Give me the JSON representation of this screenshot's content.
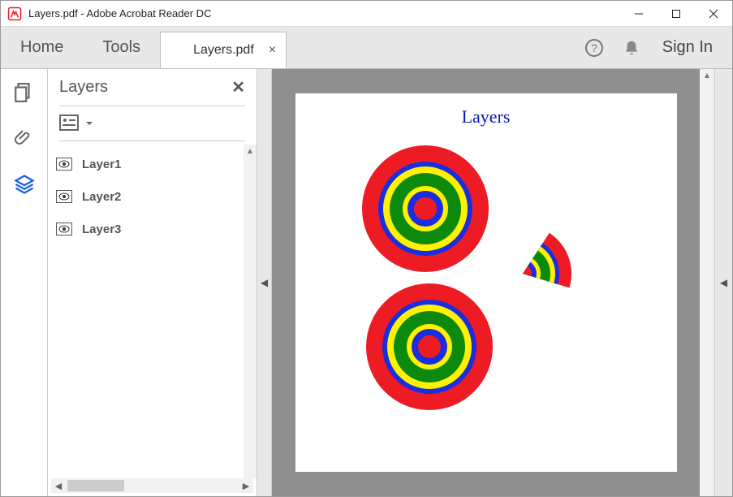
{
  "window": {
    "title": "Layers.pdf - Adobe Acrobat Reader DC"
  },
  "tabs": {
    "home": "Home",
    "tools": "Tools",
    "document": "Layers.pdf",
    "signin": "Sign In"
  },
  "panel": {
    "title": "Layers",
    "items": [
      {
        "name": "Layer1",
        "visible": true
      },
      {
        "name": "Layer2",
        "visible": true
      },
      {
        "name": "Layer3",
        "visible": true
      }
    ]
  },
  "document": {
    "title": "Layers"
  },
  "colors": {
    "ring_outer": "#ed1c24",
    "ring2": "#1a2ee0",
    "ring3": "#fff200",
    "ring4": "#0d8a0d",
    "ring5": "#fff200",
    "ring6": "#1a2ee0",
    "center": "#ed1c24"
  }
}
